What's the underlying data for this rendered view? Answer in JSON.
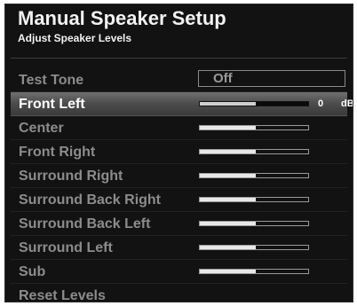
{
  "header": {
    "title": "Manual Speaker Setup",
    "subtitle": "Adjust Speaker Levels"
  },
  "rows": [
    {
      "label": "Test Tone",
      "type": "option",
      "value": "Off"
    },
    {
      "label": "Front Left",
      "type": "level",
      "level_fraction": 0.52,
      "readout": "0",
      "unit": "dB",
      "selected": true
    },
    {
      "label": "Center",
      "type": "level",
      "level_fraction": 0.52
    },
    {
      "label": "Front Right",
      "type": "level",
      "level_fraction": 0.52
    },
    {
      "label": "Surround Right",
      "type": "level",
      "level_fraction": 0.52
    },
    {
      "label": "Surround Back Right",
      "type": "level",
      "level_fraction": 0.52
    },
    {
      "label": "Surround Back Left",
      "type": "level",
      "level_fraction": 0.52
    },
    {
      "label": "Surround Left",
      "type": "level",
      "level_fraction": 0.52
    },
    {
      "label": "Sub",
      "type": "level",
      "level_fraction": 0.52
    },
    {
      "label": "Reset Levels",
      "type": "action"
    }
  ]
}
